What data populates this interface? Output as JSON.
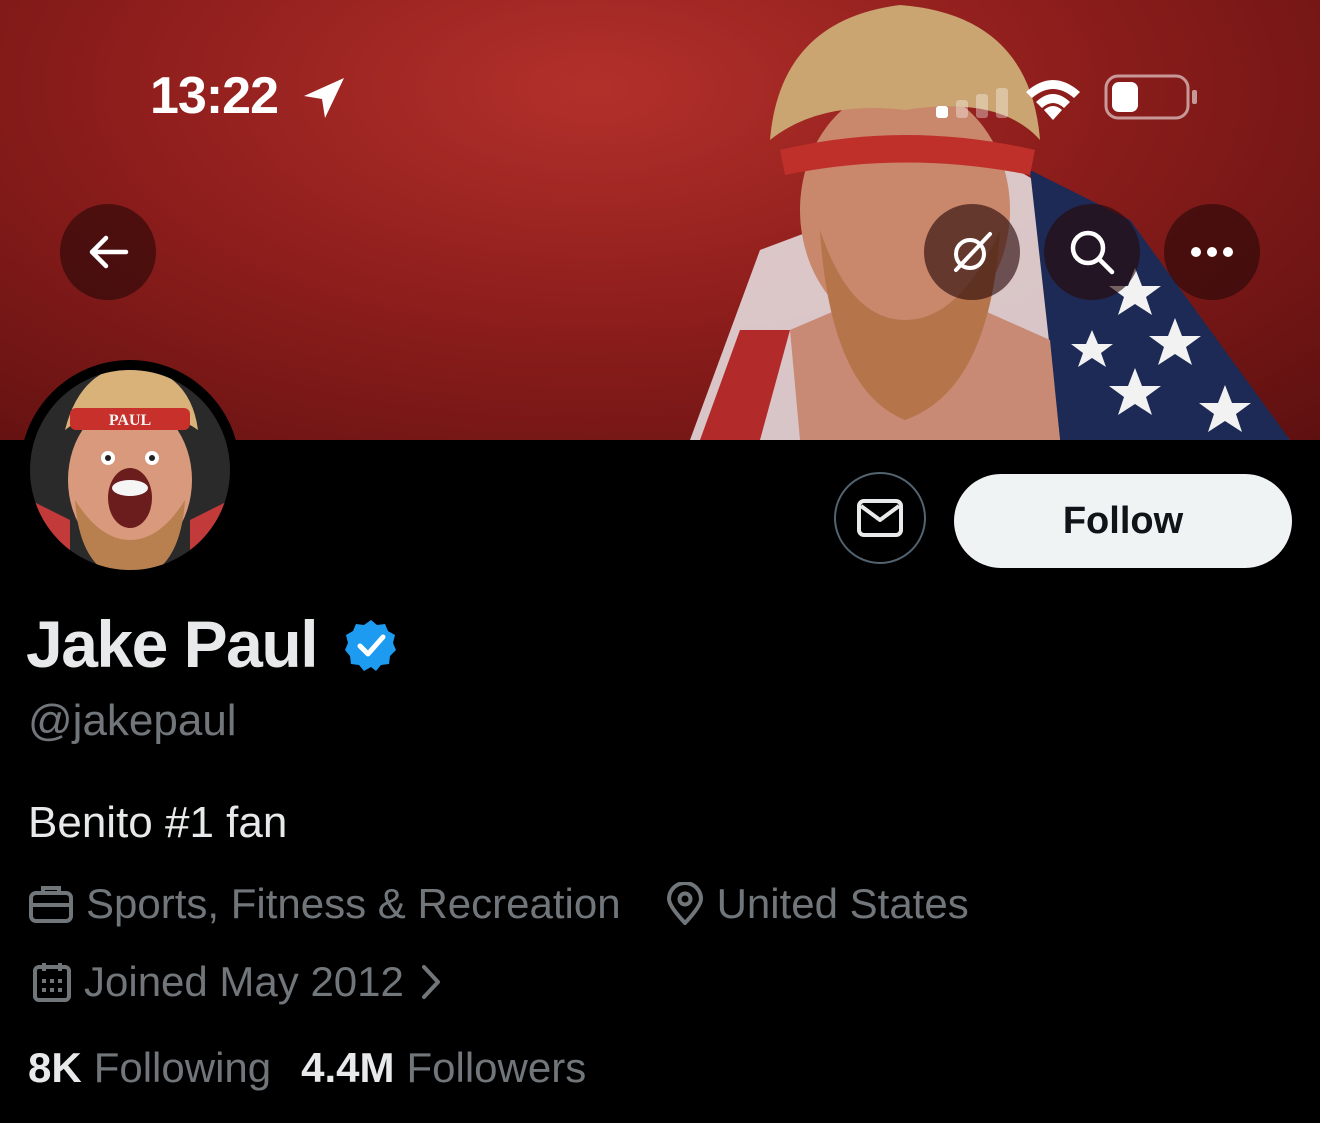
{
  "status_bar": {
    "time": "13:22"
  },
  "profile": {
    "name": "Jake Paul",
    "handle": "@jakepaul",
    "bio": "Benito #1 fan",
    "category": "Sports, Fitness & Recreation",
    "location": "United States",
    "joined": "Joined May 2012",
    "following_count": "8K",
    "following_label": "Following",
    "followers_count": "4.4M",
    "followers_label": "Followers",
    "avatar_headband_text": "PAUL"
  },
  "actions": {
    "follow_label": "Follow"
  },
  "icons": {
    "back": "arrow-left-icon",
    "grok": "grok-icon",
    "search": "search-icon",
    "more": "more-icon",
    "message": "envelope-icon",
    "verified": "verified-badge-icon",
    "category": "briefcase-icon",
    "location": "location-pin-icon",
    "joined": "calendar-icon",
    "chevron": "chevron-right-icon"
  },
  "colors": {
    "verified_blue": "#1d9bf0",
    "follow_bg": "#eff3f4",
    "muted_text": "#71767b"
  }
}
